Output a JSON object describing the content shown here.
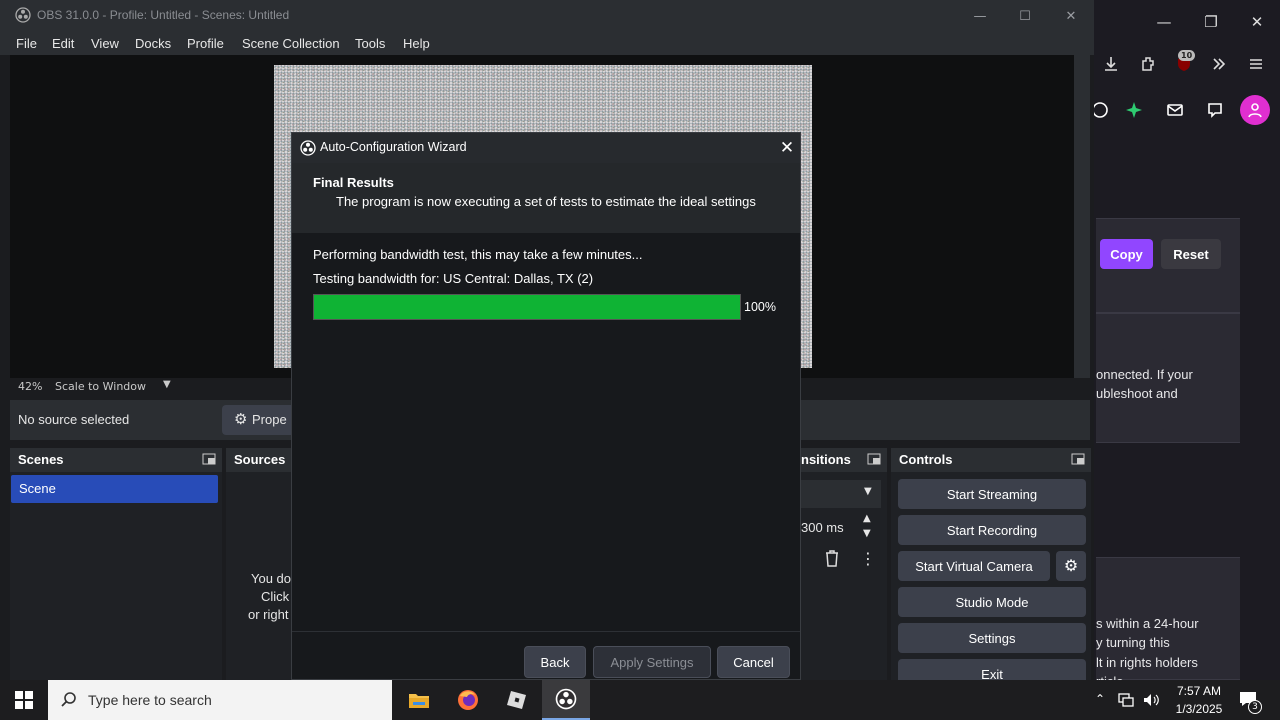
{
  "obs": {
    "title": "OBS 31.0.0 - Profile: Untitled - Scenes: Untitled",
    "menu": [
      "File",
      "Edit",
      "View",
      "Docks",
      "Profile",
      "Scene Collection",
      "Tools",
      "Help"
    ],
    "zoom": "42%",
    "scale_mode": "Scale to Window",
    "no_source": "No source selected",
    "properties_label": "Prope",
    "scenes_header": "Scenes",
    "scene_item": "Scene",
    "sources_header": "Sources",
    "sources_hint": [
      "You do",
      "Click",
      "or right"
    ],
    "transitions_header": "nsitions",
    "transition_duration": "300 ms",
    "controls_header": "Controls",
    "controls": [
      "Start Streaming",
      "Start Recording",
      "Start Virtual Camera",
      "Studio Mode",
      "Settings",
      "Exit"
    ]
  },
  "wizard": {
    "title": "Auto-Configuration Wizard",
    "heading": "Final Results",
    "subheading": "The program is now executing a set of tests to estimate the ideal settings",
    "line1": "Performing bandwidth test, this may take a few minutes...",
    "line2": "Testing bandwidth for: US Central: Dallas, TX (2)",
    "progress": 100,
    "progress_label": "100%",
    "back": "Back",
    "apply": "Apply Settings",
    "cancel": "Cancel"
  },
  "browser": {
    "badge": "10",
    "copy": "Copy",
    "reset": "Reset",
    "text1": [
      "onnected. If your",
      "ubleshoot and"
    ],
    "text2": [
      "s within a 24-hour",
      "y turning this",
      "lt in rights holders",
      "rticle"
    ],
    "accent": "#9146ff"
  },
  "taskbar": {
    "search_placeholder": "Type here to search",
    "time": "7:57 AM",
    "date": "1/3/2025",
    "notifications": "3"
  }
}
